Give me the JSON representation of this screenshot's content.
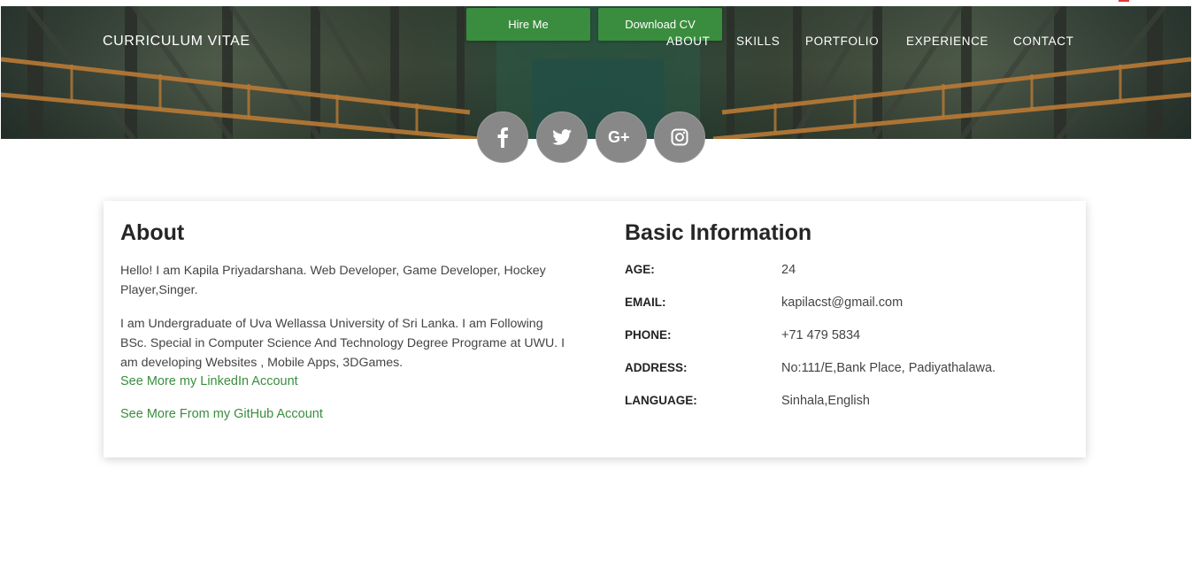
{
  "brand": {
    "name": "CURRICULUM VITAE"
  },
  "header": {
    "hire_label": "Hire Me",
    "download_label": "Download CV",
    "accent": "#3a8d3e",
    "nav": [
      {
        "label": "ABOUT"
      },
      {
        "label": "SKILLS"
      },
      {
        "label": "PORTFOLIO"
      },
      {
        "label": "EXPERIENCE"
      },
      {
        "label": "CONTACT"
      }
    ]
  },
  "social": [
    {
      "icon": "facebook-icon"
    },
    {
      "icon": "twitter-icon"
    },
    {
      "icon": "google-plus-icon"
    },
    {
      "icon": "instagram-icon"
    }
  ],
  "about": {
    "title": "About",
    "intro": "Hello! I am Kapila Priyadarshana. Web Developer, Game Developer, Hockey Player,Singer.",
    "details": "I am Undergraduate of Uva Wellassa University of Sri Lanka. I am Following BSc. Special in Computer Science And Technology Degree Programe at UWU. I am developing Websites , Mobile Apps, 3DGames.",
    "linkedin_label": "See More my LinkedIn Account",
    "github_label": "See More From my GitHub Account"
  },
  "basic_info": {
    "title": "Basic Information",
    "rows": [
      {
        "label": "AGE:",
        "value": "24"
      },
      {
        "label": "EMAIL:",
        "value": "kapilacst@gmail.com"
      },
      {
        "label": "PHONE:",
        "value": "+71 479 5834"
      },
      {
        "label": "ADDRESS:",
        "value": "No:111/E,Bank Place, Padiyathalawa."
      },
      {
        "label": "LANGUAGE:",
        "value": "Sinhala,English"
      }
    ]
  }
}
